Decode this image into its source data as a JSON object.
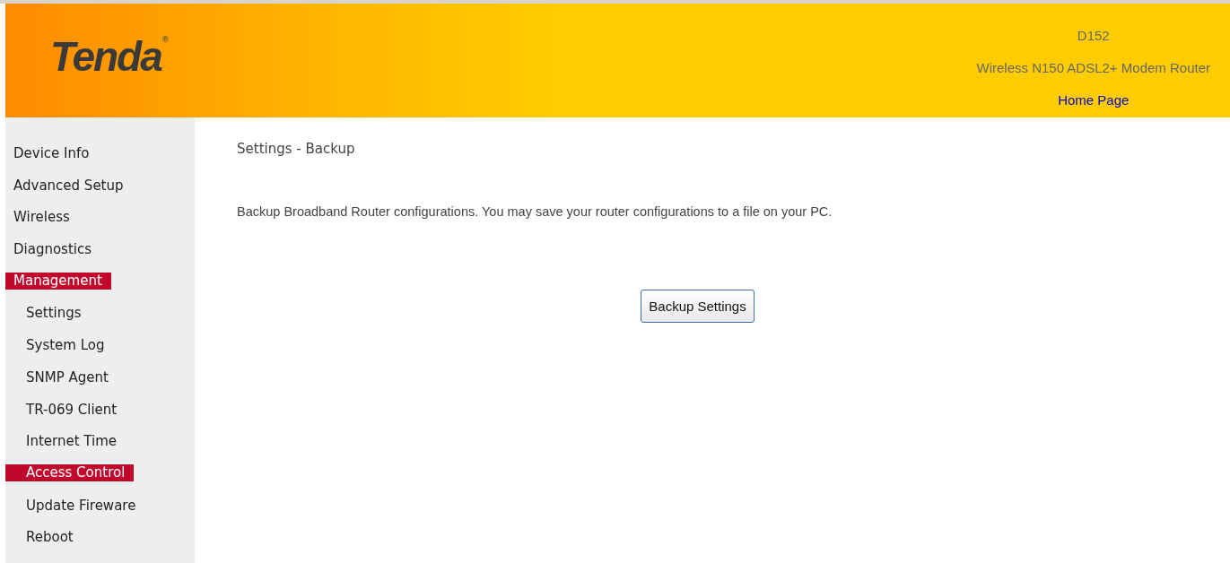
{
  "header": {
    "logo": {
      "text": "Tenda",
      "mark": "®"
    },
    "model": "D152",
    "product": "Wireless N150 ADSL2+ Modem Router",
    "home_link": "Home Page"
  },
  "sidebar": {
    "items": [
      {
        "label": "Device Info",
        "selected": false
      },
      {
        "label": "Advanced Setup",
        "selected": false
      },
      {
        "label": "Wireless",
        "selected": false
      },
      {
        "label": "Diagnostics",
        "selected": false
      },
      {
        "label": "Management",
        "selected": true,
        "children": [
          {
            "label": "Settings",
            "selected": false
          },
          {
            "label": "System Log",
            "selected": false
          },
          {
            "label": "SNMP Agent",
            "selected": false
          },
          {
            "label": "TR-069 Client",
            "selected": false
          },
          {
            "label": "Internet Time",
            "selected": false
          },
          {
            "label": "Access Control",
            "selected": true
          },
          {
            "label": "Update Fireware",
            "selected": false
          },
          {
            "label": "Reboot",
            "selected": false
          }
        ]
      }
    ]
  },
  "content": {
    "title": "Settings - Backup",
    "description": "Backup Broadband Router configurations. You may save your router configurations to a file on your PC.",
    "button": "Backup Settings"
  }
}
